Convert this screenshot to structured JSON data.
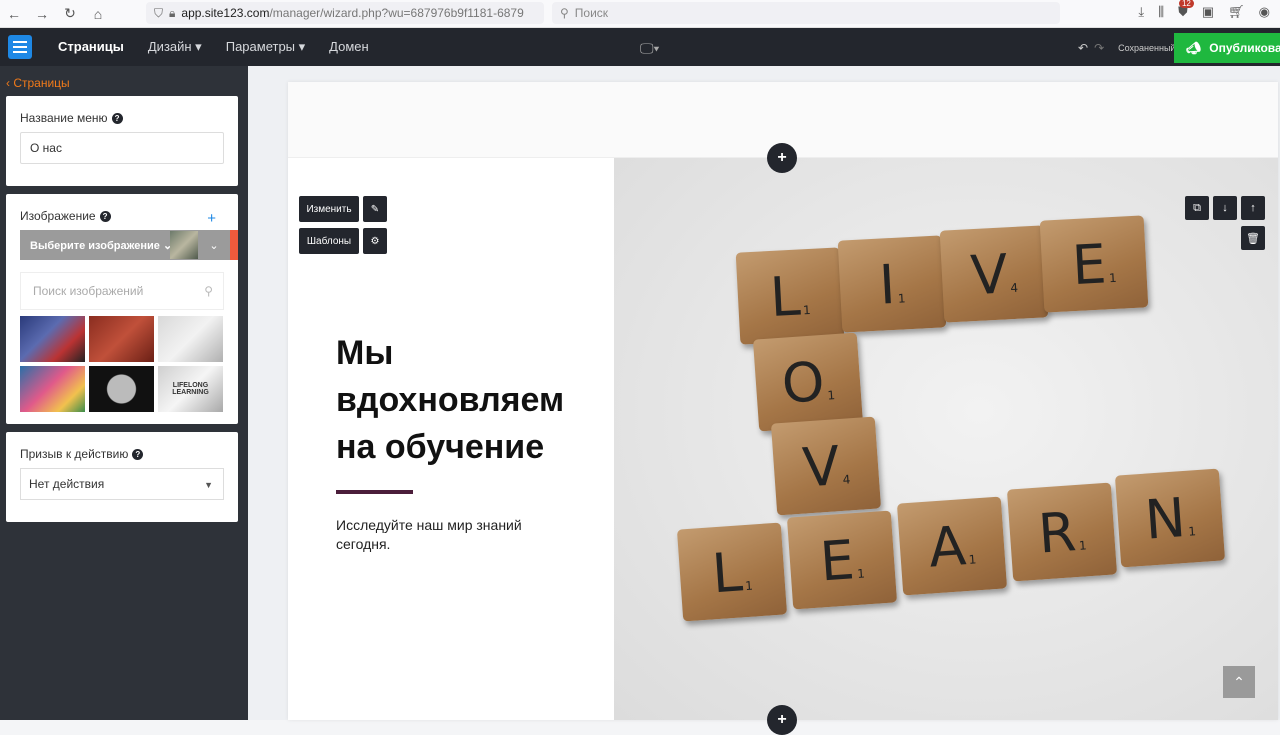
{
  "browser": {
    "url_host": "app.site123.com",
    "url_path": "/manager/wizard.php?wu=687976b9f1181-6879",
    "search_placeholder": "Поиск",
    "downloads_badge": "12"
  },
  "appbar": {
    "menu": [
      {
        "label": "Страницы"
      },
      {
        "label": "Дизайн ▾"
      },
      {
        "label": "Параметры ▾"
      },
      {
        "label": "Домен"
      }
    ],
    "saved_label": "Сохраненный",
    "publish_label": "Опубликовать"
  },
  "sidebar": {
    "back_label": "Страницы",
    "menu_name_label": "Название меню",
    "menu_name_value": "О нас",
    "image_label": "Изображение",
    "image_add": "+",
    "image_select_label": "Выберите изображение",
    "image_search_placeholder": "Поиск изображений",
    "cta_label": "Призыв к действию",
    "cta_value": "Нет действия"
  },
  "editor": {
    "change_label": "Изменить",
    "templates_label": "Шаблоны"
  },
  "hero": {
    "title": "Мы вдохновляем на обучение",
    "subtitle": "Исследуйте наш мир знаний сегодня."
  },
  "photo_tiles": [
    {
      "letter": "L",
      "score": "1"
    },
    {
      "letter": "I",
      "score": "1"
    },
    {
      "letter": "V",
      "score": "4"
    },
    {
      "letter": "E",
      "score": "1"
    },
    {
      "letter": "O",
      "score": "1"
    },
    {
      "letter": "V",
      "score": "4"
    },
    {
      "letter": "L",
      "score": "1"
    },
    {
      "letter": "E",
      "score": "1"
    },
    {
      "letter": "A",
      "score": "1"
    },
    {
      "letter": "R",
      "score": "1"
    },
    {
      "letter": "N",
      "score": "1"
    }
  ],
  "thumb_captions": {
    "lifelong": "LIFELONG LEARNING"
  },
  "colors": {
    "accent_blue": "#1e88e5",
    "publish_green": "#1fb83f",
    "back_orange": "#f07a1a",
    "hero_line": "#4b1d3a"
  }
}
